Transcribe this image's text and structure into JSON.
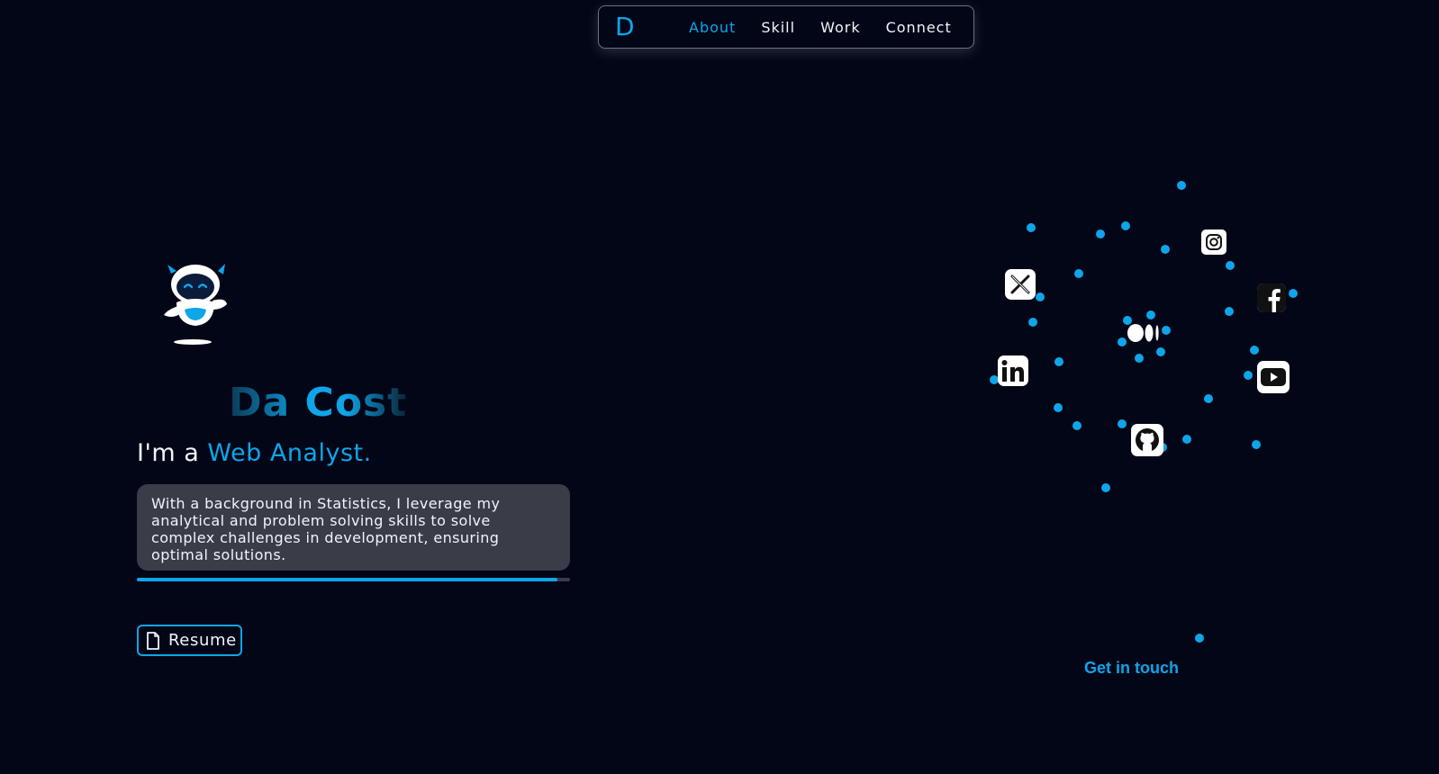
{
  "nav": {
    "logo": "D",
    "links": [
      {
        "label": "About",
        "active": true
      },
      {
        "label": "Skill",
        "active": false
      },
      {
        "label": "Work",
        "active": false
      },
      {
        "label": "Connect",
        "active": false
      }
    ]
  },
  "hero": {
    "name": "Da Cost",
    "role_prefix": "I'm a ",
    "role_value": "Web Analyst.",
    "bio": "With a background in Statistics, I leverage my analytical and problem solving skills to solve complex challenges in development, ensuring optimal solutions.",
    "progress": 0.97,
    "resume_label": "Resume"
  },
  "social": {
    "icons": [
      "x-icon",
      "instagram-icon",
      "facebook-icon",
      "linkedin-icon",
      "youtube-icon",
      "github-icon",
      "medium-icon"
    ],
    "cta": "Get in touch"
  },
  "colors": {
    "background": "#020617",
    "accent": "#0ea5e9",
    "panel": "#3a3c48",
    "text": "#f1f5f9"
  }
}
